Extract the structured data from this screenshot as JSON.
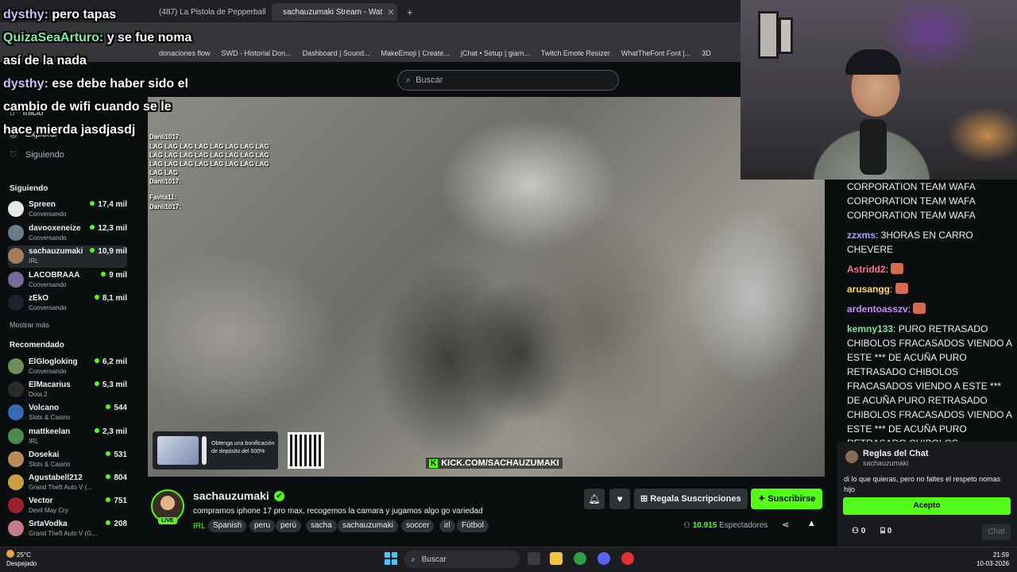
{
  "browser": {
    "tabs": [
      {
        "label": "(487) La Pistola de Pepperball N"
      },
      {
        "label": "sachauzumaki Stream - Wat"
      }
    ],
    "new_tab": "+",
    "bookmarks": [
      "donaciones flow",
      "SWD - Historial Don...",
      "Dashboard | Sound...",
      "MakeEmoji | Create...",
      "jChat • Setup | giam...",
      "Twitch Emote Resizer",
      "WhatTheFont Font |...",
      "3D"
    ]
  },
  "header": {
    "search_placeholder": "Buscar"
  },
  "sidebar": {
    "nav": [
      {
        "label": "Inicio"
      },
      {
        "label": "Explorar"
      },
      {
        "label": "Siguiendo"
      }
    ],
    "following_title": "Siguiendo",
    "following": [
      {
        "name": "Spreen",
        "sub": "Conversando",
        "viewers": "17,4 mil",
        "color": "#e9e9e9"
      },
      {
        "name": "davooxeneize",
        "sub": "Conversando",
        "viewers": "12,3 mil",
        "color": "#6b7b8c"
      },
      {
        "name": "sachauzumaki",
        "sub": "IRL",
        "viewers": "10,9 mil",
        "color": "#a87c5a"
      },
      {
        "name": "LACOBRAAA",
        "sub": "Conversando",
        "viewers": "9 mil",
        "color": "#7a6a9a"
      },
      {
        "name": "zEkO",
        "sub": "Conversando",
        "viewers": "8,1 mil",
        "color": "#1b2430"
      }
    ],
    "show_more": "Mostrar más",
    "recommended_title": "Recomendado",
    "recommended": [
      {
        "name": "ElGlogloking",
        "sub": "Conversando",
        "viewers": "6,2 mil",
        "color": "#6d8f5a"
      },
      {
        "name": "ElMacarius",
        "sub": "Dota 2",
        "viewers": "5,3 mil",
        "color": "#2a2a2a"
      },
      {
        "name": "Volcano",
        "sub": "Slots & Casino",
        "viewers": "544",
        "color": "#3a6ab0"
      },
      {
        "name": "mattkeelan",
        "sub": "IRL",
        "viewers": "2,3 mil",
        "color": "#4c8a4a"
      },
      {
        "name": "Dosekai",
        "sub": "Slots & Casino",
        "viewers": "531",
        "color": "#b88a5c"
      },
      {
        "name": "Agustabell212",
        "sub": "Grand Theft Auto V (...",
        "viewers": "804",
        "color": "#c4a040"
      },
      {
        "name": "Vector",
        "sub": "Devil May Cry",
        "viewers": "751",
        "color": "#9a2030"
      },
      {
        "name": "SrtaVodka",
        "sub": "Grand Theft Auto V (G...",
        "viewers": "208",
        "color": "#c47a8a"
      }
    ]
  },
  "video_chat": [
    {
      "user": "Danii1017:",
      "text": ""
    },
    {
      "user": "",
      "text": "LAG LAG LAG LAG LAG LAG LAG LAG"
    },
    {
      "user": "",
      "text": "LAG LAG LAG LAG LAG LAG LAG LAG"
    },
    {
      "user": "",
      "text": "LAG LAG LAG LAG LAG LAG LAG LAG"
    },
    {
      "user": "",
      "text": "LAG LAG"
    },
    {
      "user": "Danii1017:",
      "text": ""
    },
    {
      "user": "Favita11:",
      "text": ""
    },
    {
      "user": "Danii1017:",
      "text": ""
    }
  ],
  "promo": {
    "text": "Obtenga una bonificación de depósito del 500%"
  },
  "kick_link": {
    "logo": "K",
    "url": "KICK.COM/SACHAUZUMAKI"
  },
  "stream": {
    "channel": "sachauzumaki",
    "verified_glyph": "✔",
    "live": "LIVE",
    "title": "compramos iphone 17 pro max, recogemos la camara y jugamos algo go variedad",
    "category": "IRL",
    "tags": [
      "Spanish",
      "peru",
      "perú",
      "sacha",
      "sachauzumaki",
      "soccer",
      "irl",
      "Fútbol"
    ],
    "gift_label": "Regala Suscripciones",
    "subscribe_label": "Suscribirse",
    "viewers": "10.915",
    "viewers_label": "Espectadores"
  },
  "chat": {
    "messages": [
      {
        "user": "",
        "text": "CORPORATION TEAM WAFA CORPORATION TEAM WAFA CORPORATION TEAM WAFA",
        "color": "#efeff1"
      },
      {
        "user": "zzxms",
        "text": "3HORAS EN CARRO CHEVERE",
        "color": "#9fa6ff"
      },
      {
        "user": "Astridd2",
        "text": "",
        "color": "#ff6f8f"
      },
      {
        "user": "arusangg",
        "text": "",
        "color": "#ffd866"
      },
      {
        "user": "ardentoasszv",
        "text": "",
        "color": "#c88cff"
      },
      {
        "user": "kemny133",
        "text": "PURO RETRASADO CHIBOLOS FRACASADOS VIENDO A ESTE *** DE ACUÑA PURO RETRASADO CHIBOLOS FRACASADOS VIENDO A ESTE *** DE ACUÑA PURO RETRASADO CHIBOLOS FRACASADOS VIENDO A ESTE *** DE ACUÑA PURO RETRASADO CHIBOLOS",
        "color": "#7fe3a0"
      }
    ],
    "rules_title": "Reglas del Chat",
    "rules_author": "sachauzumaki",
    "rules_text": "di lo que quieras, pero no faltes el respeto nomas hijo",
    "accept_label": "Acepto",
    "count_a": "0",
    "count_b": "0",
    "send_label": "Chat"
  },
  "overlay": [
    {
      "user": "dysthy:",
      "text": "pero tapas"
    },
    {
      "user": "QuizaSeaArturo:",
      "text": "y se fue noma así de la nada"
    },
    {
      "user": "dysthy:",
      "text": "ese debe haber sido el cambio de wifi cuando se le hace mierda jasdjasdj"
    }
  ],
  "taskbar": {
    "temperature": "25°C",
    "weather": "Despejado",
    "search_label": "Buscar",
    "time": "21:59",
    "date": "10-03-2026"
  }
}
